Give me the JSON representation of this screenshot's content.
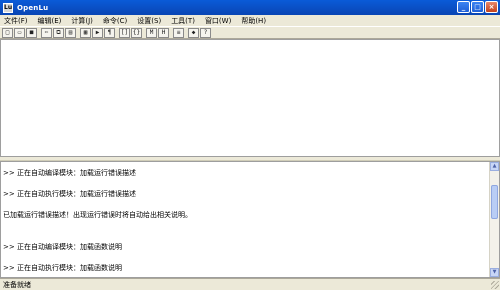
{
  "window": {
    "title": "OpenLu",
    "icon_label": "Lu",
    "minimize_symbol": "_",
    "maximize_symbol": "□",
    "close_symbol": "×"
  },
  "menu": [
    {
      "label": "文件(F)"
    },
    {
      "label": "编辑(E)"
    },
    {
      "label": "计算(J)"
    },
    {
      "label": "命令(C)"
    },
    {
      "label": "设置(S)"
    },
    {
      "label": "工具(T)"
    },
    {
      "label": "窗口(W)"
    },
    {
      "label": "帮助(H)"
    }
  ],
  "toolbar": [
    {
      "icon": "new-file-icon",
      "glyph": "□"
    },
    {
      "icon": "open-folder-icon",
      "glyph": "▭"
    },
    {
      "icon": "save-icon",
      "glyph": "■"
    },
    {
      "icon": "cut-icon",
      "glyph": "✂"
    },
    {
      "icon": "copy-icon",
      "glyph": "⧉"
    },
    {
      "icon": "paste-icon",
      "glyph": "▤"
    },
    {
      "icon": "compile-icon",
      "glyph": "▦"
    },
    {
      "icon": "run-icon",
      "glyph": "▶"
    },
    {
      "icon": "debug-icon",
      "glyph": "¶"
    },
    {
      "icon": "bracket-icon",
      "glyph": "[]"
    },
    {
      "icon": "brace-icon",
      "glyph": "{}"
    },
    {
      "icon": "function-m-icon",
      "glyph": "M"
    },
    {
      "icon": "function-h-icon",
      "glyph": "H"
    },
    {
      "icon": "list-icon",
      "glyph": "≡"
    },
    {
      "icon": "tool-icon",
      "glyph": "◆"
    },
    {
      "icon": "help-icon",
      "glyph": "?"
    }
  ],
  "output": {
    "lines": [
      {
        "text": ">> 正在自动编译模块：加载运行错误描述"
      },
      {
        "text": ""
      },
      {
        "text": ">> 正在自动执行模块：加载运行错误描述"
      },
      {
        "text": ""
      },
      {
        "text": "已加载运行错误描述！出现运行错误时将自动给出相关说明。"
      },
      {
        "text": ""
      },
      {
        "text": ""
      },
      {
        "text": ">> 正在自动编译模块：加载函数说明"
      },
      {
        "text": ""
      },
      {
        "text": ">> 正在自动执行模块：加载函数说明"
      }
    ]
  },
  "status": {
    "text": "准备就绪"
  }
}
